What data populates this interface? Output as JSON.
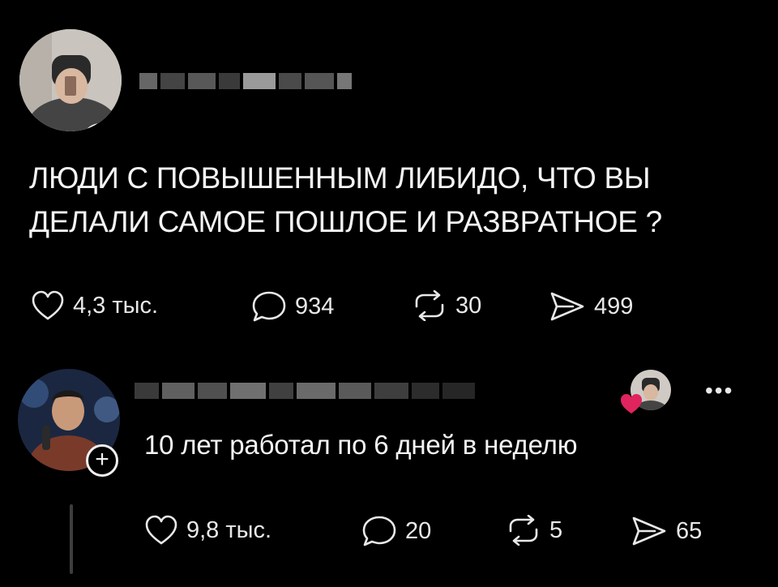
{
  "post": {
    "author_redacted": true,
    "text_line1": "ЛЮДИ С ПОВЫШЕННЫМ ЛИБИДО, ЧТО ВЫ",
    "text_line2": "ДЕЛАЛИ САМОЕ ПОШЛОЕ И РАЗВРАТНОЕ ?",
    "likes": "4,3 тыс.",
    "comments": "934",
    "reposts": "30",
    "shares": "499"
  },
  "reply": {
    "author_redacted": true,
    "text": "10 лет работал по 6 дней в неделю",
    "likes": "9,8 тыс.",
    "comments": "20",
    "reposts": "5",
    "shares": "65",
    "more_label": "•••",
    "follow_label": "+",
    "liked_by_author": true
  },
  "colors": {
    "background": "#000000",
    "text": "#f2f2f2",
    "heart_badge": "#e0245e"
  },
  "icons": [
    "heart-icon",
    "comment-icon",
    "repost-icon",
    "share-icon",
    "more-icon",
    "plus-icon"
  ]
}
